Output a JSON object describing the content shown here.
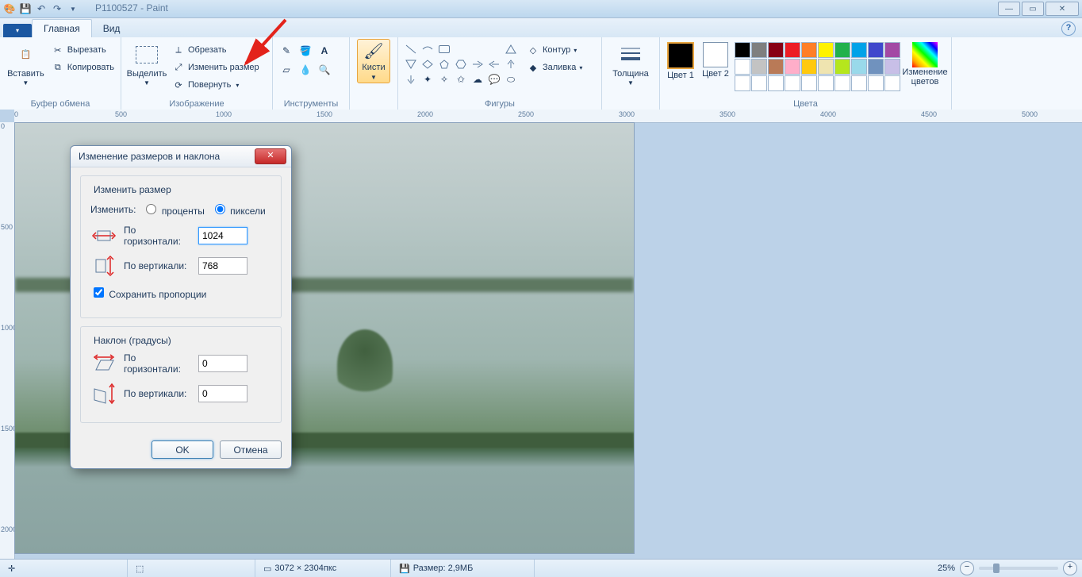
{
  "title": "P1100527 - Paint",
  "tabs": {
    "file": "",
    "main": "Главная",
    "view": "Вид"
  },
  "ribbon": {
    "clipboard": {
      "paste": "Вставить",
      "cut": "Вырезать",
      "copy": "Копировать",
      "label": "Буфер обмена"
    },
    "image": {
      "select": "Выделить",
      "crop": "Обрезать",
      "resize": "Изменить размер",
      "rotate": "Повернуть",
      "label": "Изображение"
    },
    "tools": {
      "label": "Инструменты"
    },
    "brushes": {
      "label": "Кисти"
    },
    "shapes": {
      "outline": "Контур",
      "fill": "Заливка",
      "label": "Фигуры"
    },
    "size": {
      "label": "Толщина"
    },
    "colors": {
      "c1": "Цвет 1",
      "c2": "Цвет 2",
      "edit": "Изменение цветов",
      "label": "Цвета"
    }
  },
  "ruler": {
    "h": [
      "0",
      "500",
      "1000",
      "1500",
      "2000",
      "2500",
      "3000",
      "3500",
      "4000",
      "4500",
      "5000"
    ],
    "v": [
      "0",
      "500",
      "1000",
      "1500",
      "2000"
    ]
  },
  "dialog": {
    "title": "Изменение размеров и наклона",
    "resize_legend": "Изменить размер",
    "by": "Изменить:",
    "percent": "проценты",
    "pixels": "пиксели",
    "horizontal": "По горизонтали:",
    "vertical": "По вертикали:",
    "h_val": "1024",
    "v_val": "768",
    "aspect": "Сохранить пропорции",
    "skew_legend": "Наклон (градусы)",
    "sk_h": "0",
    "sk_v": "0",
    "ok": "OK",
    "cancel": "Отмена"
  },
  "status": {
    "dims": "3072 × 2304пкс",
    "size": "Размер: 2,9МБ",
    "zoom": "25%"
  },
  "palette_row1": [
    "#000000",
    "#7f7f7f",
    "#880015",
    "#ed1c24",
    "#ff7f27",
    "#fff200",
    "#22b14c",
    "#00a2e8",
    "#3f48cc",
    "#a349a4"
  ],
  "palette_row2": [
    "#ffffff",
    "#c3c3c3",
    "#b97a57",
    "#ffaec9",
    "#ffc90e",
    "#efe4b0",
    "#b5e61d",
    "#99d9ea",
    "#7092be",
    "#c8bfe7"
  ],
  "palette_row3": [
    "#ffffff",
    "#ffffff",
    "#ffffff",
    "#ffffff",
    "#ffffff",
    "#ffffff",
    "#ffffff",
    "#ffffff",
    "#ffffff",
    "#ffffff"
  ]
}
